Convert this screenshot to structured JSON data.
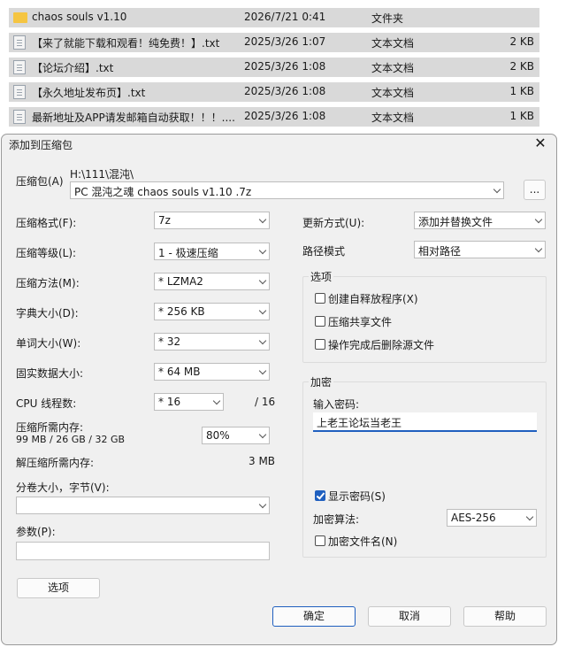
{
  "files": [
    {
      "name": "chaos souls v1.10",
      "date": "2026/7/21 0:41",
      "type": "文件夹",
      "size": "",
      "icon": "folder-icon"
    },
    {
      "name": "【来了就能下载和观看！纯免费！】.txt",
      "date": "2025/3/26 1:07",
      "type": "文本文档",
      "size": "2 KB",
      "icon": "text-file-icon"
    },
    {
      "name": "【论坛介绍】.txt",
      "date": "2025/3/26 1:08",
      "type": "文本文档",
      "size": "2 KB",
      "icon": "text-file-icon"
    },
    {
      "name": "【永久地址发布页】.txt",
      "date": "2025/3/26 1:08",
      "type": "文本文档",
      "size": "1 KB",
      "icon": "text-file-icon"
    },
    {
      "name": "最新地址及APP请发邮箱自动获取！！！....",
      "date": "2025/3/26 1:08",
      "type": "文本文档",
      "size": "1 KB",
      "icon": "text-file-icon"
    }
  ],
  "dialog": {
    "title": "添加到压缩包",
    "close": "✕",
    "archive_label": "压缩包(A)",
    "archive_path": "H:\\111\\混沌\\",
    "archive_name": "PC 混沌之魂 chaos souls v1.10 .7z",
    "browse": "...",
    "format_label": "压缩格式(F):",
    "format_value": "7z",
    "level_label": "压缩等级(L):",
    "level_value": "1 - 极速压缩",
    "method_label": "压缩方法(M):",
    "method_value": "*  LZMA2",
    "dict_label": "字典大小(D):",
    "dict_value": "*  256 KB",
    "word_label": "单词大小(W):",
    "word_value": "*  32",
    "solid_label": "固实数据大小:",
    "solid_value": "*  64 MB",
    "cpu_label": "CPU 线程数:",
    "cpu_value": "*  16",
    "cpu_total": "/ 16",
    "mem_label": "压缩所需内存:",
    "mem_detail": "99 MB / 26 GB / 32 GB",
    "mem_percent": "80%",
    "decomp_label": "解压缩所需内存:",
    "decomp_value": "3 MB",
    "volume_label": "分卷大小，字节(V):",
    "volume_value": "",
    "params_label": "参数(P):",
    "params_value": "",
    "options_button": "选项",
    "update_label": "更新方式(U):",
    "update_value": "添加并替换文件",
    "pathmode_label": "路径模式",
    "pathmode_value": "相对路径",
    "options_group": "选项",
    "opt_sfx": "创建自释放程序(X)",
    "opt_shared": "压缩共享文件",
    "opt_delete": "操作完成后删除源文件",
    "enc_group": "加密",
    "password_label": "输入密码:",
    "password_value": "上老王论坛当老王",
    "show_password": "显示密码(S)",
    "enc_method_label": "加密算法:",
    "enc_method_value": "AES-256",
    "encrypt_names": "加密文件名(N)",
    "ok": "确定",
    "cancel": "取消",
    "help": "帮助"
  }
}
